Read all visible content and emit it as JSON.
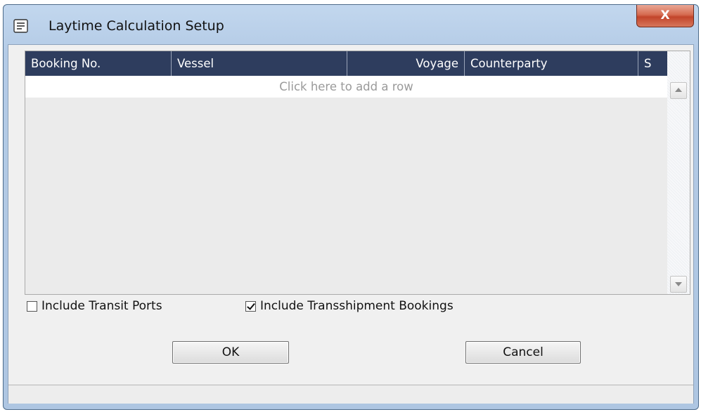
{
  "window": {
    "title": "Laytime Calculation Setup",
    "close_label": "X"
  },
  "grid": {
    "columns": [
      "Booking No.",
      "Vessel",
      "Voyage",
      "Counterparty",
      "S"
    ],
    "add_row_text": "Click here to add a row"
  },
  "options": {
    "include_transit_ports": {
      "label": "Include Transit Ports",
      "checked": false
    },
    "include_transshipment": {
      "label": "Include Transshipment Bookings",
      "checked": true
    }
  },
  "buttons": {
    "ok": "OK",
    "cancel": "Cancel"
  },
  "icons": {
    "window": "document-list-icon",
    "close": "close-icon",
    "scroll_up": "arrow-up-icon",
    "scroll_down": "arrow-down-icon"
  },
  "colors": {
    "header_bg": "#2e3d5e",
    "close_bg": "#c2452b"
  }
}
